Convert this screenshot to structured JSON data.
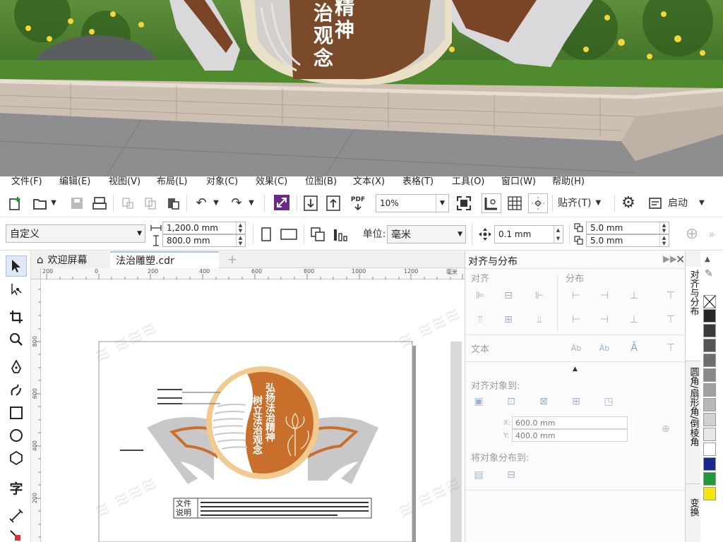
{
  "menu": [
    "文件(F)",
    "编辑(E)",
    "视图(V)",
    "布局(L)",
    "对象(C)",
    "效果(C)",
    "位图(B)",
    "文本(X)",
    "表格(T)",
    "工具(O)",
    "窗口(W)",
    "帮助(H)"
  ],
  "toolbar": {
    "zoom_value": "10%",
    "pdf_label": "PDF",
    "snap_label": "贴齐(T)",
    "launch_label": "启动"
  },
  "property_bar": {
    "page_size": "自定义",
    "width": "1,200.0 mm",
    "height": "800.0 mm",
    "unit_label": "单位:",
    "unit_value": "毫米",
    "nudge": "0.1 mm",
    "dup_x": "5.0 mm",
    "dup_y": "5.0 mm"
  },
  "doc_tabs": {
    "welcome": "欢迎屏幕",
    "file": "法治雕塑.cdr",
    "add": "+"
  },
  "ruler": {
    "h_ticks": [
      "200",
      "0",
      "200",
      "400",
      "600",
      "800",
      "1000",
      "1200"
    ],
    "unit": "毫米",
    "v_ticks": [
      "800",
      "600",
      "400",
      "200"
    ]
  },
  "artwork": {
    "vertical_text_left": "树立法治观念",
    "vertical_text_right": "弘扬法治精神",
    "note_label_1": "文件",
    "note_label_2": "说明"
  },
  "photo": {
    "sign_text_1": "精",
    "sign_text_2": "神",
    "sign_text_3": "观",
    "sign_text_4": "念",
    "sign_text_5": "治"
  },
  "docker": {
    "title": "对齐与分布",
    "align": "对齐",
    "distribute": "分布",
    "text": "文本",
    "align_to": "对齐对象到:",
    "x_value": "600.0 mm",
    "y_value": "400.0 mm",
    "x_label": "X:",
    "y_label": "Y:",
    "distribute_to": "将对象分布到:"
  },
  "side_tabs": [
    "对齐与分布",
    "圆角/扇形角/倒棱角",
    "变换"
  ],
  "palette": [
    "#2b2522",
    "#3a3a3a",
    "#555555",
    "#6e6e6e",
    "#888888",
    "#a0a0a0",
    "#b8b8b8",
    "#d0d0d0",
    "#e8e8e8",
    "#ffffff",
    "#1a2a8c",
    "#1f9a3a",
    "#f5e50a"
  ],
  "colors": {
    "accent_orange": "#c8702b",
    "cream": "#f2c98e",
    "panel_gray": "#c9c9c9"
  }
}
